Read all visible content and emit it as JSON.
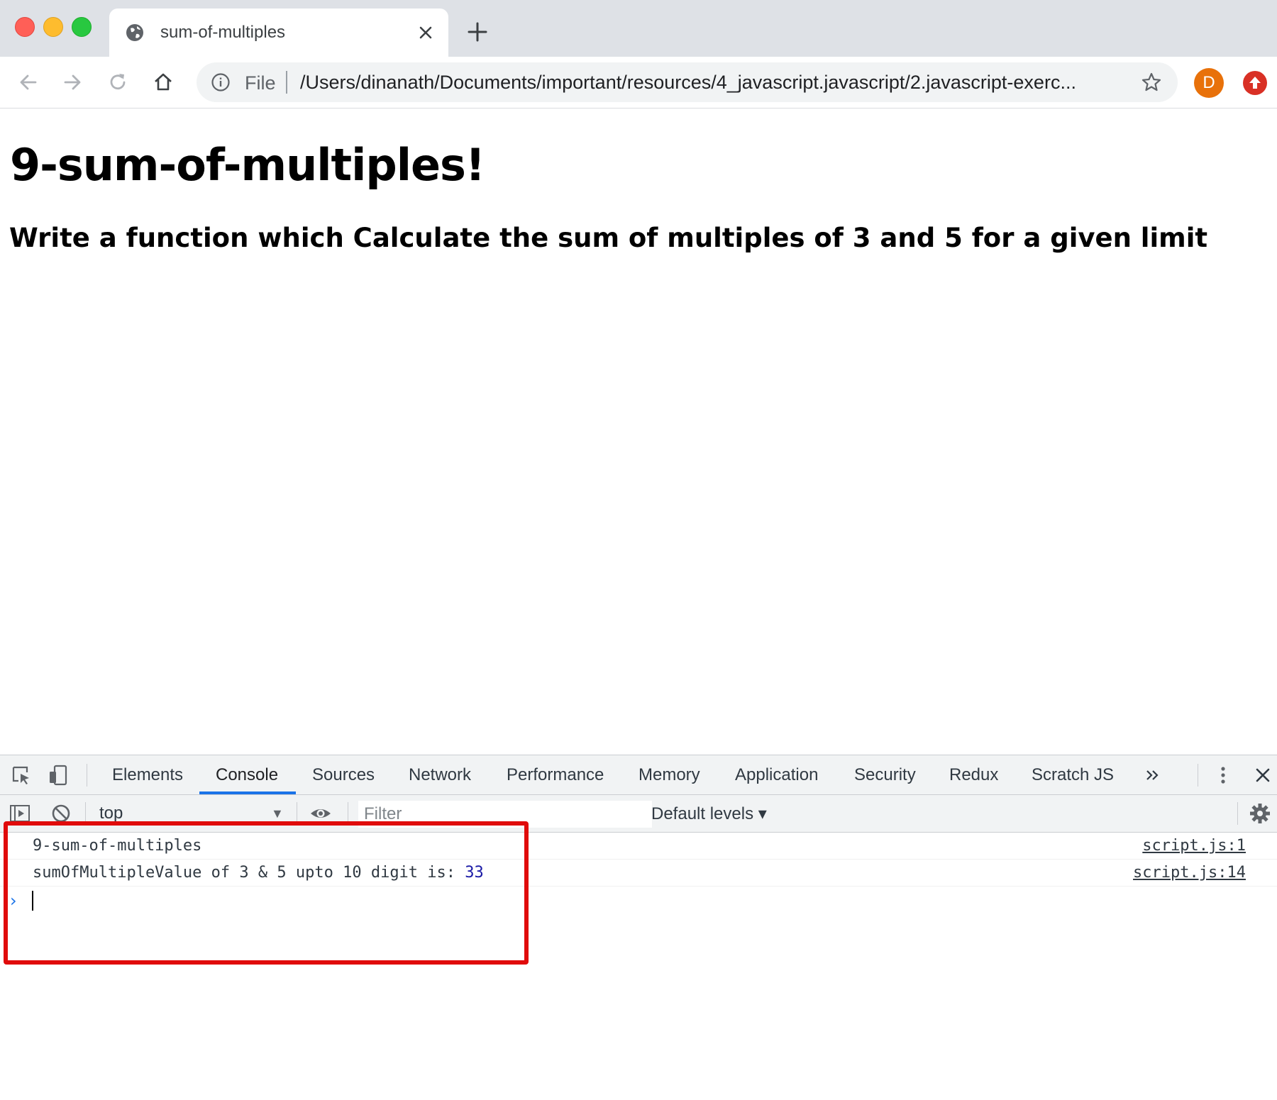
{
  "browser": {
    "tab_title": "sum-of-multiples",
    "omnibox": {
      "scheme": "File",
      "url": "/Users/dinanath/Documents/important/resources/4_javascript.javascript/2.javascript-exerc..."
    },
    "profile_initial": "D"
  },
  "page": {
    "title": "9-sum-of-multiples!",
    "subtitle": "Write a function which Calculate the sum of multiples of 3 and 5 for a given limit"
  },
  "devtools": {
    "tabs": [
      "Elements",
      "Console",
      "Sources",
      "Network",
      "Performance",
      "Memory",
      "Application",
      "Security",
      "Redux",
      "Scratch JS"
    ],
    "active_tab": "Console",
    "context": "top",
    "filter_placeholder": "Filter",
    "levels": "Default levels",
    "console_logs": [
      {
        "message": "9-sum-of-multiples",
        "source": "script.js:1"
      },
      {
        "message": "sumOfMultipleValue of 3 & 5 upto 10 digit is: ",
        "value": "33",
        "source": "script.js:14"
      }
    ]
  },
  "colors": {
    "highlight": "#e00b0b",
    "accent": "#1a73e8",
    "number": "#1a1aa6"
  }
}
